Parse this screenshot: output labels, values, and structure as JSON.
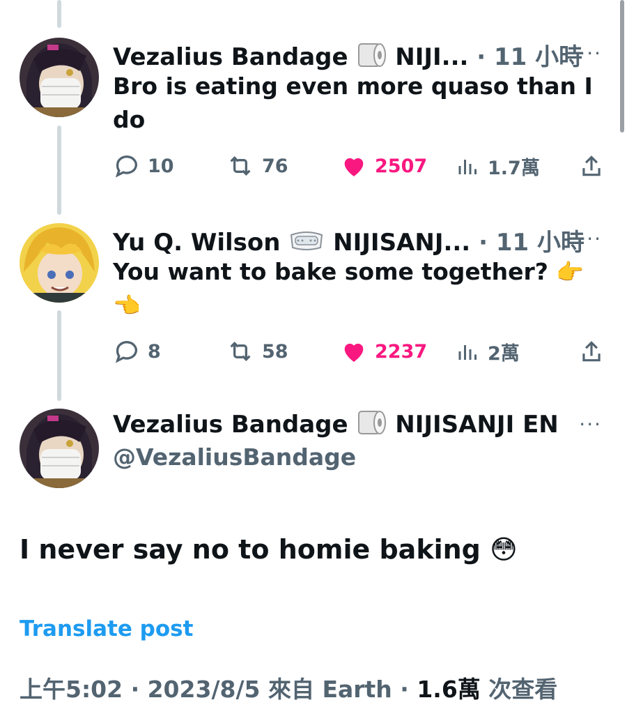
{
  "tweets": [
    {
      "author": "Vezalius Bandage",
      "truncated_suffix": "NIJI...",
      "badge_icon": "toilet-paper-icon",
      "time": "· 11 小時",
      "text": "Bro is eating even more quaso than I do",
      "stats": {
        "replies": "10",
        "retweets": "76",
        "likes": "2507",
        "views": "1.7萬"
      }
    },
    {
      "author": "Yu Q. Wilson",
      "truncated_suffix": "NIJISANJ...",
      "badge_icon": "goggles-icon",
      "time": "· 11 小時",
      "text": "You want to bake some together?",
      "emoji_inline": "👉",
      "emoji_line2": "👈",
      "stats": {
        "replies": "8",
        "retweets": "58",
        "likes": "2237",
        "views": "2萬"
      }
    }
  ],
  "main_post": {
    "author": "Vezalius Bandage",
    "badge_icon": "toilet-paper-icon",
    "org": "NIJISANJI EN",
    "handle": "@VezaliusBandage",
    "text": "I never say no to homie baking",
    "emoji": "😳",
    "translate_label": "Translate post",
    "meta_time": "上午5:02 · 2023/8/5 來自 Earth · ",
    "meta_views": "1.6萬",
    "meta_views_suffix": " 次查看"
  },
  "more_label": "···",
  "colors": {
    "like": "#f91880",
    "link": "#1d9bf0",
    "muted": "#536471"
  }
}
